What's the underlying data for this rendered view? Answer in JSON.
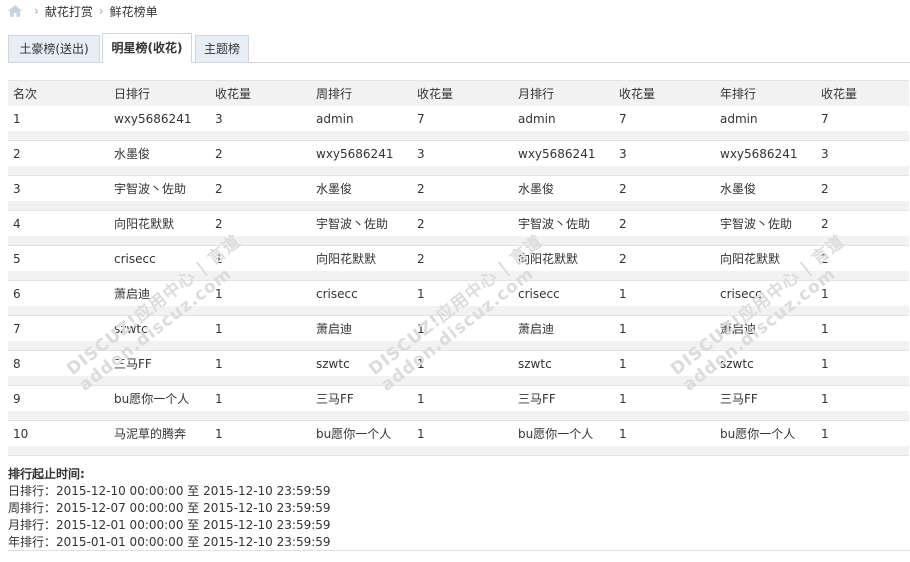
{
  "breadcrumb": {
    "items": [
      "献花打赏",
      "鲜花榜单"
    ]
  },
  "tabs": [
    {
      "label": "土豪榜(送出)",
      "active": false
    },
    {
      "label": "明星榜(收花)",
      "active": true
    },
    {
      "label": "主题榜",
      "active": false
    }
  ],
  "table": {
    "headers": [
      "名次",
      "日排行",
      "收花量",
      "周排行",
      "收花量",
      "月排行",
      "收花量",
      "年排行",
      "收花量"
    ],
    "rows": [
      [
        "1",
        "wxy5686241",
        "3",
        "admin",
        "7",
        "admin",
        "7",
        "admin",
        "7"
      ],
      [
        "2",
        "水墨俊",
        "2",
        "wxy5686241",
        "3",
        "wxy5686241",
        "3",
        "wxy5686241",
        "3"
      ],
      [
        "3",
        "宇智波丶佐助",
        "2",
        "水墨俊",
        "2",
        "水墨俊",
        "2",
        "水墨俊",
        "2"
      ],
      [
        "4",
        "向阳花默默",
        "2",
        "宇智波丶佐助",
        "2",
        "宇智波丶佐助",
        "2",
        "宇智波丶佐助",
        "2"
      ],
      [
        "5",
        "crisecc",
        "1",
        "向阳花默默",
        "2",
        "向阳花默默",
        "2",
        "向阳花默默",
        "2"
      ],
      [
        "6",
        "萧启迪",
        "1",
        "crisecc",
        "1",
        "crisecc",
        "1",
        "crisecc",
        "1"
      ],
      [
        "7",
        "szwtc",
        "1",
        "萧启迪",
        "1",
        "萧启迪",
        "1",
        "萧启迪",
        "1"
      ],
      [
        "8",
        "三马FF",
        "1",
        "szwtc",
        "1",
        "szwtc",
        "1",
        "szwtc",
        "1"
      ],
      [
        "9",
        "bu愿你一个人",
        "1",
        "三马FF",
        "1",
        "三马FF",
        "1",
        "三马FF",
        "1"
      ],
      [
        "10",
        "马泥草的腾奔",
        "1",
        "bu愿你一个人",
        "1",
        "bu愿你一个人",
        "1",
        "bu愿你一个人",
        "1"
      ]
    ]
  },
  "ranges": {
    "title": "排行起止时间:",
    "lines": [
      "日排行：2015-12-10 00:00:00 至 2015-12-10 23:59:59",
      "周排行：2015-12-07 00:00:00 至 2015-12-10 23:59:59",
      "月排行：2015-12-01 00:00:00 至 2015-12-10 23:59:59",
      "年排行：2015-01-01 00:00:00 至 2015-12-10 23:59:59"
    ]
  },
  "watermark": {
    "line1": "DISCUZ!应用中心 | 言道",
    "line2": "addon.discuz.com"
  }
}
